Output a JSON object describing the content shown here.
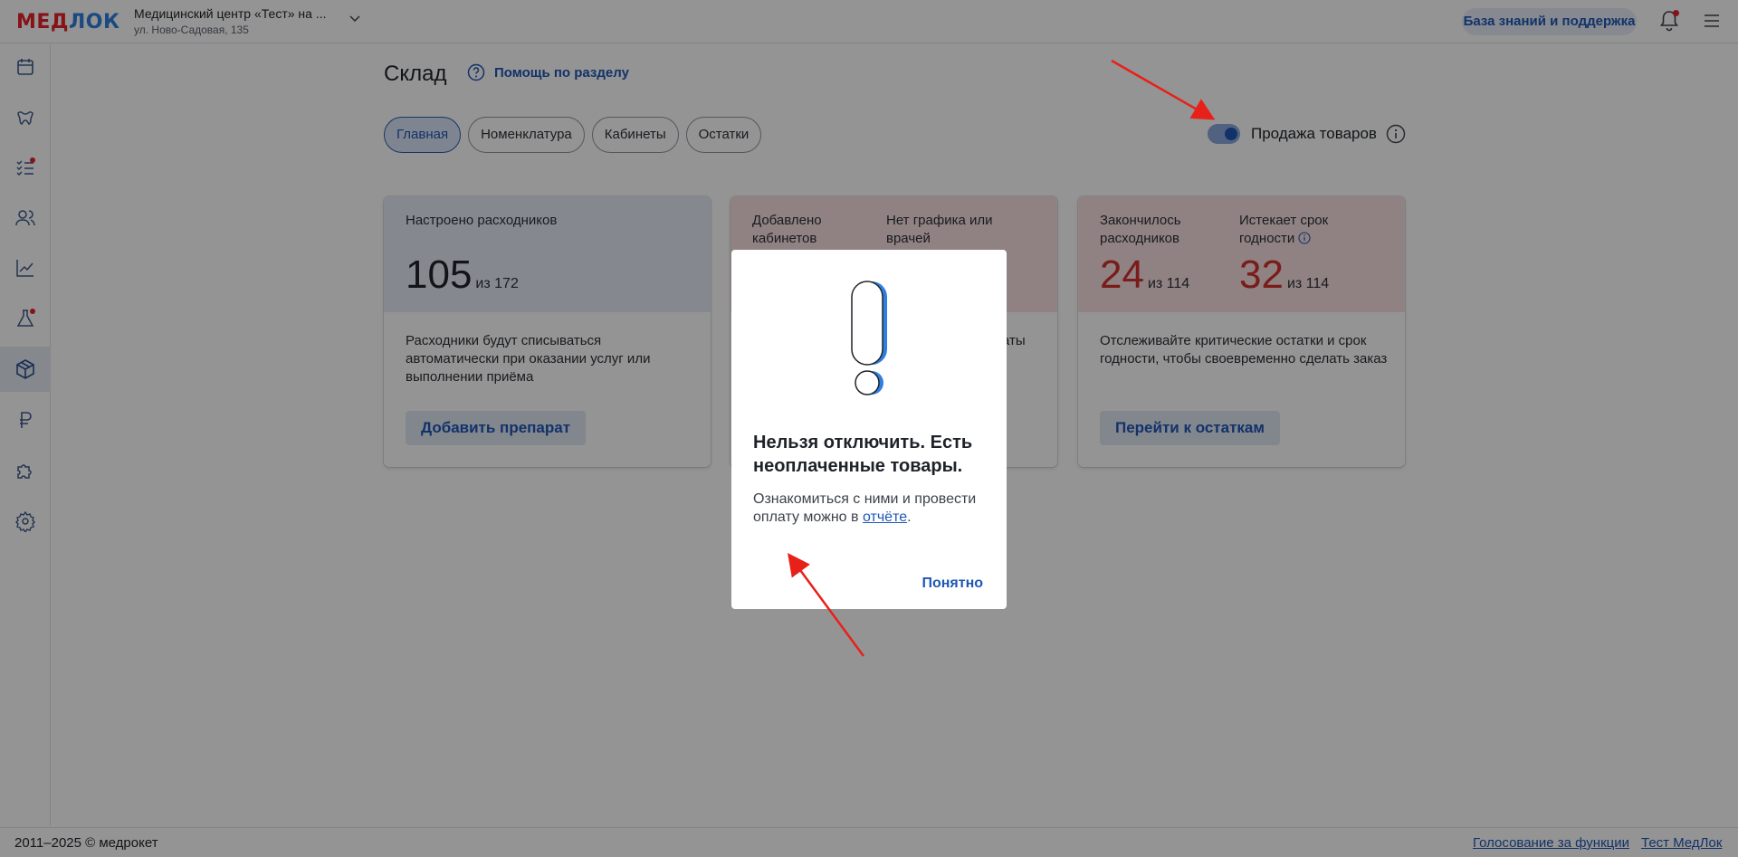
{
  "header": {
    "logo_part1": "МЕД",
    "logo_part2": "ЛОК",
    "clinic_name": "Медицинский центр «Тест» на ...",
    "clinic_address": "ул. Ново-Садовая, 135",
    "kb_button": "База знаний и поддержка"
  },
  "sidebar": {
    "items": [
      "calendar-icon",
      "tooth-icon",
      "checklist-icon",
      "users-icon",
      "chart-icon",
      "flask-icon",
      "box-icon",
      "ruble-icon",
      "puzzle-icon",
      "gear-icon"
    ],
    "active": "box-icon"
  },
  "page": {
    "title": "Склад",
    "help": "Помощь по разделу",
    "tabs": [
      "Главная",
      "Номенклатура",
      "Кабинеты",
      "Остатки"
    ],
    "active_tab": "Главная",
    "toggle_label": "Продажа товаров",
    "toggle_on": true
  },
  "cards": [
    {
      "label": "Настроено расходников",
      "value": "105",
      "of": "из 172",
      "desc": "Расходники будут списываться автоматически при оказании услуг или выполнении приёма",
      "button": "Добавить препарат"
    },
    {
      "label1": "Добавлено кабинетов",
      "label2": "Нет графика или врачей",
      "desc_tail": "аты"
    },
    {
      "label1": "Закончилось расходников",
      "value1": "24",
      "of1": "из 114",
      "label2": "Истекает срок годности",
      "value2": "32",
      "of2": "из 114",
      "desc": "Отслеживайте критические остатки и срок годности, чтобы своевременно сделать заказ",
      "button": "Перейти к остаткам"
    }
  ],
  "modal": {
    "title": "Нельзя отключить. Есть неоплаченные товары.",
    "body_prefix": "Ознакомиться с ними и провести оплату можно в ",
    "body_link": "отчёте",
    "body_suffix": ".",
    "ok": "Понятно"
  },
  "footer": {
    "copyright": "2011–2025 © медрокет",
    "link1": "Голосование за функции",
    "link2": "Тест МедЛок"
  },
  "colors": {
    "accent": "#1f57b5",
    "danger": "#d0312d",
    "annotation_arrow": "#e8201a"
  }
}
